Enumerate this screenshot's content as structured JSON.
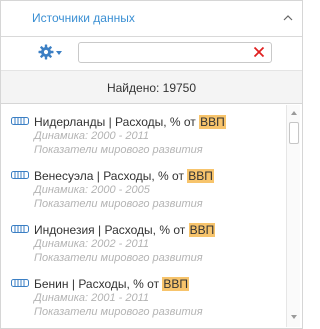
{
  "header": {
    "title": "Источники данных",
    "chevron_icon": "chevron-up-icon",
    "accent_color": "#3a8fd3"
  },
  "toolbar": {
    "settings_icon": "gear-icon",
    "search": {
      "value": "",
      "placeholder": ""
    },
    "clear_icon": "close-icon",
    "clear_color": "#e02020"
  },
  "found": {
    "label": "Найдено: 19750"
  },
  "results": [
    {
      "country": "Нидерланды",
      "sep": " | ",
      "measure": "Расходы, % от ",
      "highlight": "ВВП",
      "dynamics": "Динамика: 2000 - 2011",
      "source": "Показатели мирового развития"
    },
    {
      "country": "Венесуэла",
      "sep": " | ",
      "measure": "Расходы, % от ",
      "highlight": "ВВП",
      "dynamics": "Динамика: 2000 - 2005",
      "source": "Показатели мирового развития"
    },
    {
      "country": "Индонезия",
      "sep": " | ",
      "measure": "Расходы, % от ",
      "highlight": "ВВП",
      "dynamics": "Динамика: 2002 - 2011",
      "source": "Показатели мирового развития"
    },
    {
      "country": "Бенин",
      "sep": " | ",
      "measure": "Расходы, % от ",
      "highlight": "ВВП",
      "dynamics": "Динамика: 2001 - 2011",
      "source": "Показатели мирового развития"
    }
  ],
  "colors": {
    "highlight": "#f7c46c",
    "meta_text": "#b3b3b3",
    "icon_blue": "#3b7fc4"
  }
}
